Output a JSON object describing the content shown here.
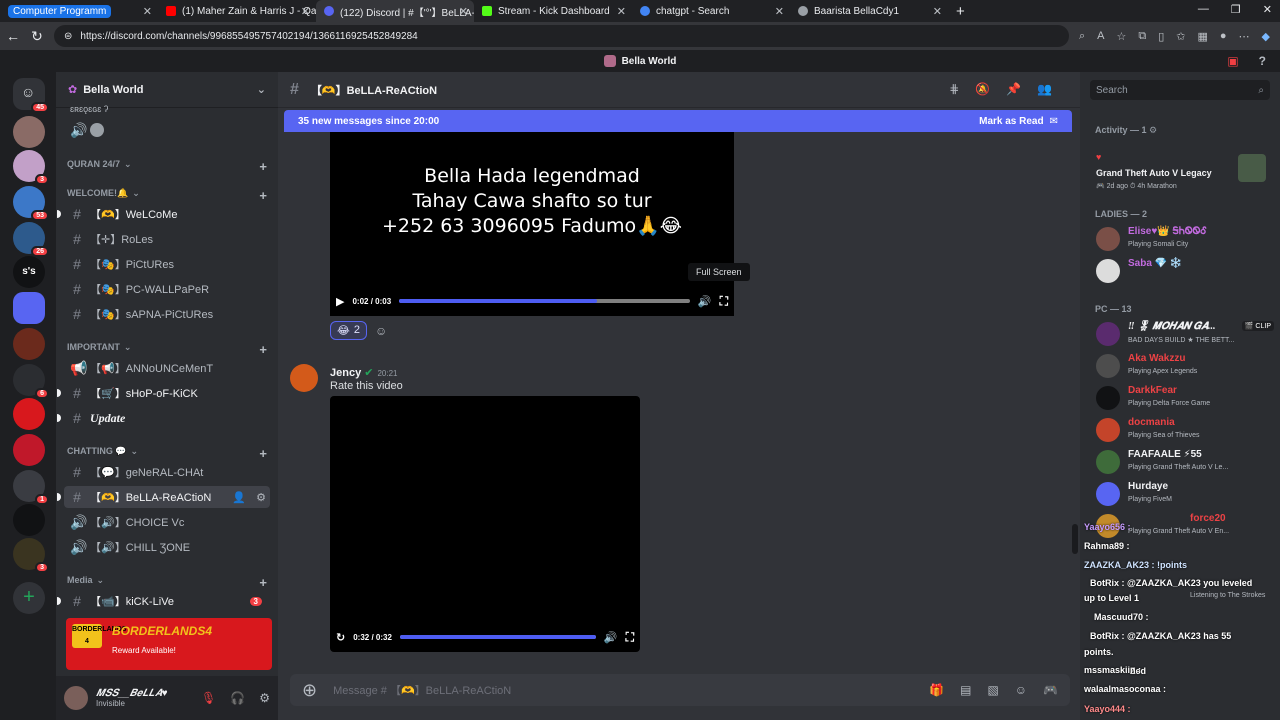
{
  "browser": {
    "tabs": [
      {
        "label": "Computer Programm",
        "color": "#1a73e8"
      },
      {
        "label": "(1) Maher Zain & Harris J - Qalbi",
        "color": "#ff0000"
      },
      {
        "label": "(122) Discord | #【'°'】BeLLA-ReAC",
        "color": "#5865f2"
      },
      {
        "label": "Stream - Kick Dashboard",
        "color": "#53fc18"
      },
      {
        "label": "chatgpt - Search",
        "color": "#4285f4"
      },
      {
        "label": "Baarista BellaCdy1",
        "color": "#9aa0a6"
      }
    ],
    "new_tab": "+",
    "url": "https://discord.com/channels/996855495757402194/1366116925452849284",
    "win_controls": {
      "min": "—",
      "max": "❐",
      "close": "✕"
    }
  },
  "title_bar": {
    "title": "Bella World"
  },
  "server_badges": [
    "45",
    "3",
    "53",
    "26",
    "6",
    "1",
    "3"
  ],
  "server_text": "s's",
  "guild": {
    "name": "Bella World"
  },
  "categories": {
    "quran": "Quran 24/7",
    "welcome": "WELCOME!🔔",
    "important": "IMPORTANT",
    "chatting": "CHATTING 💬",
    "media": "Media"
  },
  "channels": {
    "top_cut": "ɛʀɛǫɛɢɛ ʔ",
    "welcome": "【🫶】WeLCoMe",
    "roles": "【✛】RoLes",
    "pictures": "【🎭】PiCtURes",
    "wallpaper": "【🎭】PC-WALLPaPeR",
    "sapna": "【🎭】sAPNA-PiCtURes",
    "announcement": "【📢】ANNoUNCeMenT",
    "shop": "【🛒】sHoP-oF-KiCK",
    "update": "Update",
    "general": "【💬】geNeRAL-CHAt",
    "reaction": "【🫶】BeLLA-ReACtioN",
    "choice": "【🔊】CHOICE Vc",
    "chill": "【🔊】CHILL ƷONE",
    "kick": "【📹】kiCK-LiVe",
    "kick_badge": "3"
  },
  "promo": {
    "logo": "BORDERLANDS 4",
    "title": "BORDERLANDS4",
    "subtitle": "Reward Available!"
  },
  "user": {
    "name": "𝑴𝑺𝑺__𝑩𝒆𝑳𝑳𝑨♥",
    "status": "Invisible"
  },
  "header": {
    "channel": "【🫶】BeLLA-ReACtioN",
    "search": "Search"
  },
  "new_messages": {
    "text": "35 new messages since 20:00",
    "action": "Mark as Read"
  },
  "video1": {
    "lines": [
      "Bella Hada legendmad",
      "Tahay Cawa shafto so tur",
      "+252 63 3096095 Fadumo🙏😂"
    ],
    "time": "0:02 / 0:03",
    "progress": 0.68,
    "tooltip": "Full Screen"
  },
  "reaction": {
    "emoji": "😂",
    "count": "2"
  },
  "message2": {
    "author": "Jency",
    "time": "20:21",
    "text": "Rate this video"
  },
  "video2": {
    "time": "0:32 / 0:32",
    "progress": 1.0
  },
  "composer": {
    "placeholder": "Message # 【🫶】BeLLA-ReACtioN"
  },
  "members": {
    "activity_header": "Activity — 1",
    "activity": {
      "title": "Grand Theft Auto V Legacy",
      "sub": "🎮 2d ago  ⏱ 4h Marathon"
    },
    "ladies_header": "LADIES — 2",
    "ladies": [
      {
        "name": "Elise♥👑 ᎦᏂᏫᏫᎴ",
        "activity": "Playing Somali City",
        "color": "#c26bdf"
      },
      {
        "name": "Saba 💎 ❄️",
        "activity": "",
        "color": "#c26bdf"
      }
    ],
    "pc_header": "PC — 13",
    "pc": [
      {
        "name": "‼ 🎖 𝑴𝑶𝑯𝑨𝑵 𝑮𝑨...",
        "activity": "BAD DAYS BUILD ★ THE BETT...",
        "color": "#f2f3f5"
      },
      {
        "name": "Aka Wakzzu",
        "activity": "Playing Apex Legends",
        "color": "#ed4245"
      },
      {
        "name": "DarkkFear",
        "activity": "Playing Delta Force Game",
        "color": "#ed4245"
      },
      {
        "name": "docmania",
        "activity": "Playing Sea of Thieves",
        "color": "#ed4245"
      },
      {
        "name": "FAAFAALE ⚡55",
        "activity": "Playing Grand Theft Auto V Le...",
        "color": "#f2f3f5"
      },
      {
        "name": "Hurdaye",
        "activity": "Playing FiveM",
        "color": "#f2f3f5"
      },
      {
        "name": "force20",
        "activity": "Playing Grand Theft Auto V En...",
        "color": "#ed4245"
      }
    ],
    "clip_badge": "🎬 CLIP",
    "listening": "Listening to The Strokes"
  },
  "overlay_chat": [
    "Yaayo656 :",
    "Rahma89 :",
    "ZAAZKA_AK23 : !points",
    "BotRix : @ZAAZKA_AK23 you leveled",
    "up to Level 1",
    "Mascuud70 :",
    "BotRix : @ZAAZKA_AK23 has 55",
    "points.",
    "Zed",
    "mssmaskiin :",
    "walaalmasoconaa :",
    "Yaayo444 :"
  ],
  "colors": {
    "accent": "#5865f2",
    "red": "#f23f43",
    "bg": "#313338"
  }
}
